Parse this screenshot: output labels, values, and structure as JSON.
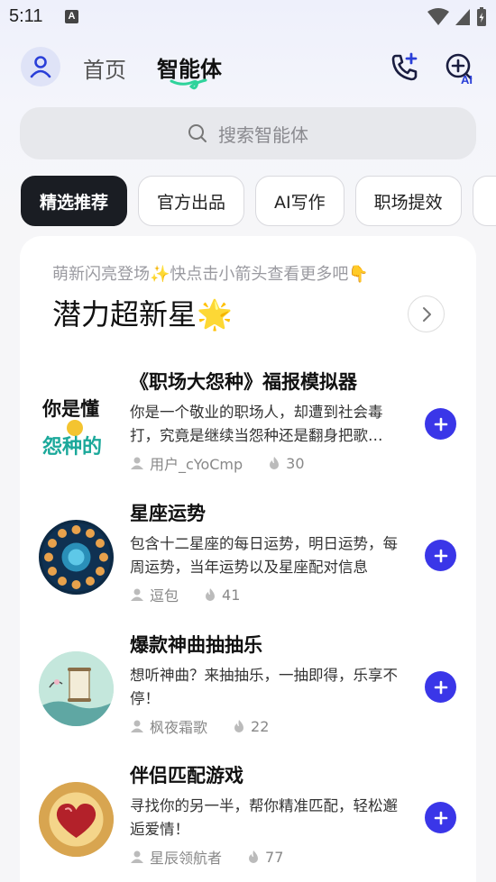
{
  "status": {
    "time": "5:11",
    "notif": "A"
  },
  "header": {
    "nav_home": "首页",
    "nav_agent": "智能体",
    "ai_badge": "AI"
  },
  "search": {
    "placeholder": "搜索智能体"
  },
  "tabs": [
    "精选推荐",
    "官方出品",
    "AI写作",
    "职场提效"
  ],
  "section": {
    "subtitle": "萌新闪亮登场✨快点击小箭头查看更多吧👇",
    "title": "潜力超新星🌟"
  },
  "items": [
    {
      "title": "《职场大怨种》福报模拟器",
      "desc": "你是一个敬业的职场人，却遭到社会毒打，究竟是继续当怨种还是翻身把歌…",
      "user": "用户_cYoCmp",
      "count": "30",
      "thumb_text1": "你是懂",
      "thumb_text2": "怨种的"
    },
    {
      "title": "星座运势",
      "desc": "包含十二星座的每日运势，明日运势，每周运势，当年运势以及星座配对信息",
      "user": "逗包",
      "count": "41"
    },
    {
      "title": "爆款神曲抽抽乐",
      "desc": "想听神曲？来抽抽乐，一抽即得，乐享不停！",
      "user": "枫夜霜歌",
      "count": "22"
    },
    {
      "title": "伴侣匹配游戏",
      "desc": "寻找你的另一半，帮你精准匹配，轻松邂逅爱情！",
      "user": "星辰领航者",
      "count": "77"
    }
  ],
  "colors": {
    "accent": "#3a36e8",
    "active_tab": "#1a1d23",
    "underline": "#2fd39b"
  }
}
